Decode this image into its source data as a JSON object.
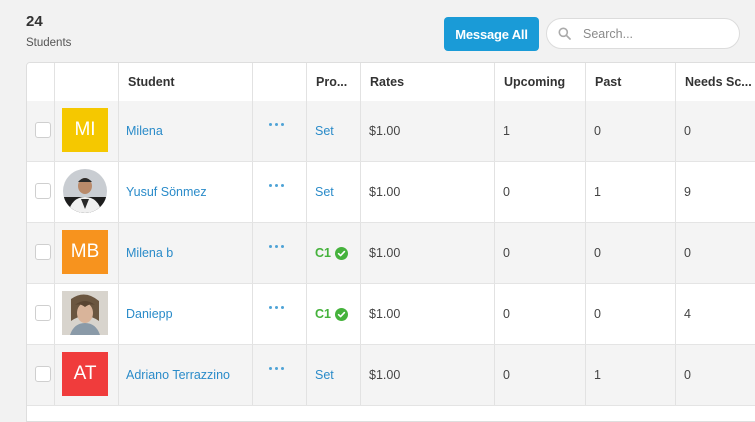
{
  "header": {
    "count": "24",
    "count_label": "Students",
    "message_all_label": "Message All",
    "search_placeholder": "Search...",
    "search_icon": "search-icon"
  },
  "table": {
    "columns": [
      "",
      "",
      "Student",
      "",
      "Pro...",
      "Rates",
      "Upcoming",
      "Past",
      "Needs Sc..."
    ],
    "rows": [
      {
        "avatar_text": "MI",
        "avatar_color": "#f5c800",
        "avatar_type": "initials",
        "name": "Milena",
        "plan": "Set",
        "plan_level": false,
        "rate": "$1.00",
        "upcoming": "1",
        "past": "0",
        "needs": "0"
      },
      {
        "avatar_text": "",
        "avatar_color": "#ffffff",
        "avatar_type": "photo",
        "name": "Yusuf Sönmez",
        "plan": "Set",
        "plan_level": false,
        "rate": "$1.00",
        "upcoming": "0",
        "past": "1",
        "needs": "9"
      },
      {
        "avatar_text": "MB",
        "avatar_color": "#f7931e",
        "avatar_type": "initials",
        "name": "Milena b",
        "plan": "C1",
        "plan_level": true,
        "rate": "$1.00",
        "upcoming": "0",
        "past": "0",
        "needs": "0"
      },
      {
        "avatar_text": "",
        "avatar_color": "#ffffff",
        "avatar_type": "photo",
        "name": "Daniepp",
        "plan": "C1",
        "plan_level": true,
        "rate": "$1.00",
        "upcoming": "0",
        "past": "0",
        "needs": "4"
      },
      {
        "avatar_text": "AT",
        "avatar_color": "#f03c3c",
        "avatar_type": "initials",
        "name": "Adriano Terrazzino",
        "plan": "Set",
        "plan_level": false,
        "rate": "$1.00",
        "upcoming": "0",
        "past": "1",
        "needs": "0"
      }
    ]
  }
}
